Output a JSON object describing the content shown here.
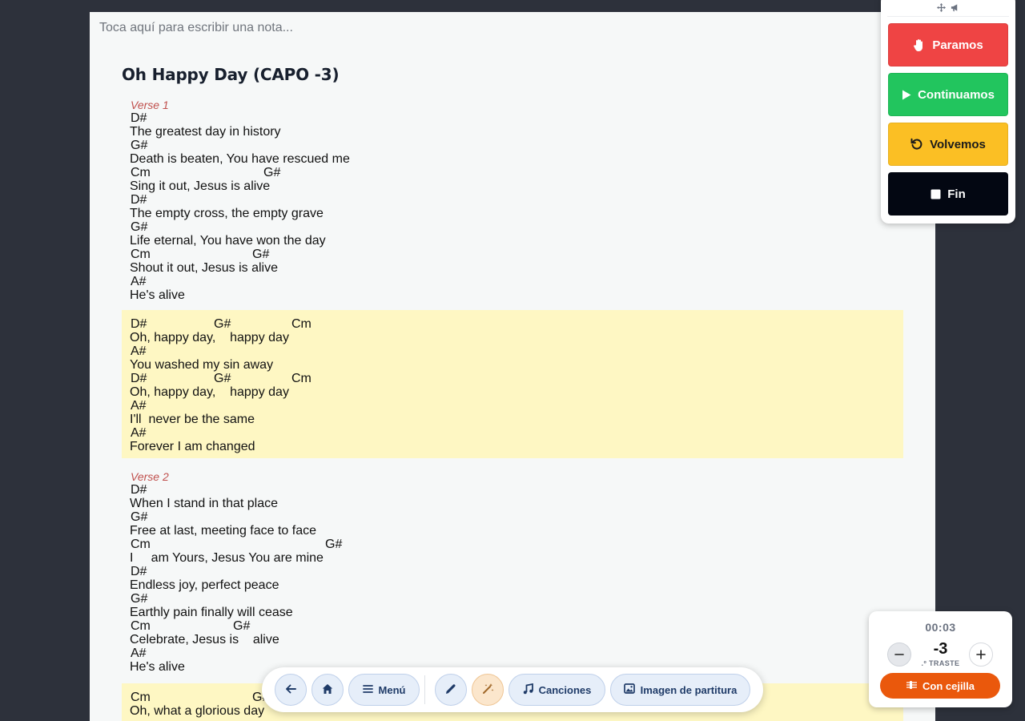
{
  "note": {
    "placeholder": "Toca aquí para escribir una nota..."
  },
  "song": {
    "title": "Oh Happy Day (CAPO -3)",
    "sections": [
      {
        "label": "Verse 1",
        "highlight": false,
        "lines": [
          {
            "chords": [
              {
                "t": "D#",
                "pos": 0
              }
            ],
            "lyric": "The greatest day in history"
          },
          {
            "chords": [
              {
                "t": "G#",
                "pos": 0
              }
            ],
            "lyric": "Death is beaten, You have rescued me"
          },
          {
            "chords": [
              {
                "t": "Cm",
                "pos": 0
              },
              {
                "t": "G#",
                "pos": 166
              }
            ],
            "lyric": "Sing it out, Jesus is alive"
          },
          {
            "chords": [
              {
                "t": "D#",
                "pos": 0
              }
            ],
            "lyric": "The empty cross, the empty grave"
          },
          {
            "chords": [
              {
                "t": "G#",
                "pos": 0
              }
            ],
            "lyric": "Life eternal, You have won the day"
          },
          {
            "chords": [
              {
                "t": "Cm",
                "pos": 0
              },
              {
                "t": "G#",
                "pos": 152
              }
            ],
            "lyric": "Shout it out, Jesus is alive"
          },
          {
            "chords": [
              {
                "t": "A#",
                "pos": 0
              }
            ],
            "lyric": "He's alive"
          }
        ]
      },
      {
        "label": "",
        "highlight": true,
        "lines": [
          {
            "chords": [
              {
                "t": "D#",
                "pos": 0
              },
              {
                "t": "G#",
                "pos": 104
              },
              {
                "t": "Cm",
                "pos": 201
              }
            ],
            "lyric": "Oh, happy day,    happy day"
          },
          {
            "chords": [
              {
                "t": "A#",
                "pos": 0
              }
            ],
            "lyric": "You washed my sin away"
          },
          {
            "chords": [
              {
                "t": "D#",
                "pos": 0
              },
              {
                "t": "G#",
                "pos": 104
              },
              {
                "t": "Cm",
                "pos": 201
              }
            ],
            "lyric": "Oh, happy day,    happy day"
          },
          {
            "chords": [
              {
                "t": "A#",
                "pos": 0
              }
            ],
            "lyric": "I'll  never be the same"
          },
          {
            "chords": [
              {
                "t": "A#",
                "pos": 0
              }
            ],
            "lyric": "Forever I am changed"
          }
        ]
      },
      {
        "label": "Verse 2",
        "highlight": false,
        "lines": [
          {
            "chords": [
              {
                "t": "D#",
                "pos": 0
              }
            ],
            "lyric": "When I stand in that place"
          },
          {
            "chords": [
              {
                "t": "G#",
                "pos": 0
              }
            ],
            "lyric": "Free at last, meeting face to face"
          },
          {
            "chords": [
              {
                "t": "Cm",
                "pos": 0
              },
              {
                "t": "G#",
                "pos": 243
              }
            ],
            "lyric": "I     am Yours, Jesus You are mine"
          },
          {
            "chords": [
              {
                "t": "D#",
                "pos": 0
              }
            ],
            "lyric": "Endless joy, perfect peace"
          },
          {
            "chords": [
              {
                "t": "G#",
                "pos": 0
              }
            ],
            "lyric": "Earthly pain finally will cease"
          },
          {
            "chords": [
              {
                "t": "Cm",
                "pos": 0
              },
              {
                "t": "G#",
                "pos": 128
              }
            ],
            "lyric": "Celebrate, Jesus is    alive"
          },
          {
            "chords": [
              {
                "t": "A#",
                "pos": 0
              }
            ],
            "lyric": "He's alive"
          }
        ]
      },
      {
        "label": "",
        "highlight": true,
        "lines": [
          {
            "chords": [
              {
                "t": "Cm",
                "pos": 0
              },
              {
                "t": "G#",
                "pos": 152
              }
            ],
            "lyric": "Oh, what a glorious day"
          }
        ]
      }
    ]
  },
  "cues": {
    "handle_icons": [
      "move-icon",
      "megaphone-icon"
    ],
    "buttons": [
      {
        "id": "stop",
        "label": "Paramos",
        "icon": "hand-icon",
        "color": "#ef4444"
      },
      {
        "id": "continue",
        "label": "Continuamos",
        "icon": "play-icon",
        "color": "#22c55e"
      },
      {
        "id": "repeat",
        "label": "Volvemos",
        "icon": "rotate-left-icon",
        "color": "#fbbf24"
      },
      {
        "id": "end",
        "label": "Fin",
        "icon": "square-icon",
        "color": "#030712"
      }
    ]
  },
  "capo": {
    "timer": "00:03",
    "value": "-3",
    "unit": ".º TRASTE",
    "toggle_label": "Con cejilla",
    "toggle_color": "#ea580c"
  },
  "toolbar": {
    "menu_label": "Menú",
    "songs_label": "Canciones",
    "sheet_image_label": "Imagen de partitura"
  }
}
